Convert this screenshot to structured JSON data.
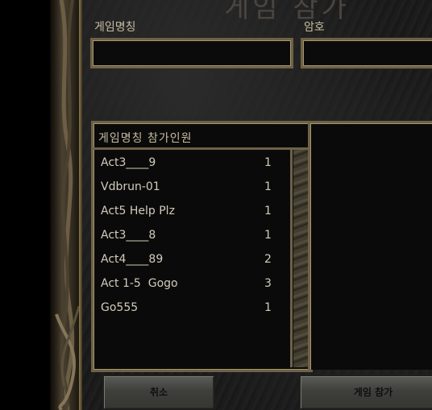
{
  "window": {
    "title": "게임 참가"
  },
  "form": {
    "game_name_label": "게임명칭",
    "password_label": "암호",
    "game_name_value": "",
    "password_value": ""
  },
  "list": {
    "header": "게임명칭 참가인원",
    "rows": [
      {
        "name": "Act3____9",
        "count": "1"
      },
      {
        "name": "Vdbrun-01",
        "count": "1"
      },
      {
        "name": "Act5 Help Plz",
        "count": "1"
      },
      {
        "name": "Act3____8",
        "count": "1"
      },
      {
        "name": "Act4____89",
        "count": "2"
      },
      {
        "name": "Act 1-5  Gogo",
        "count": "3"
      },
      {
        "name": "Go555",
        "count": "1"
      }
    ]
  },
  "buttons": {
    "cancel": "취소",
    "join": "게임 참가"
  },
  "colors": {
    "gold_border": "#6d6248",
    "label_text": "#c6bca0",
    "list_text": "#d2ccbc"
  },
  "icons": {
    "pillar": "twisted-vine-pillar-icon",
    "scrollbar": "celtic-knot-scrollbar"
  }
}
